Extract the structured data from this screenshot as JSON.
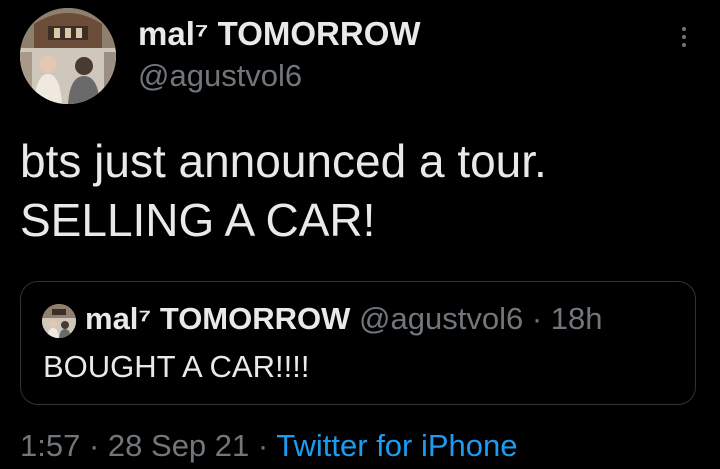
{
  "tweet": {
    "author": {
      "display_name": "mal⁷ TOMORROW",
      "handle": "@agustvol6",
      "avatar_icon": "profile-photo-avatar"
    },
    "more_icon": "more-options-icon",
    "text_lines": [
      "bts just announced a tour.",
      "SELLING A CAR!"
    ],
    "quoted": {
      "display_name": "mal⁷ TOMORROW",
      "handle": "@agustvol6",
      "separator": "·",
      "time": "18h",
      "text": "BOUGHT A CAR!!!!"
    },
    "meta": {
      "time": "1:57",
      "separator": "·",
      "date": "28 Sep 21",
      "source": "Twitter for iPhone"
    }
  },
  "colors": {
    "background": "#000000",
    "text": "#e7e9ea",
    "secondary": "#71767b",
    "link": "#1d9bf0",
    "border": "#2f3336"
  }
}
